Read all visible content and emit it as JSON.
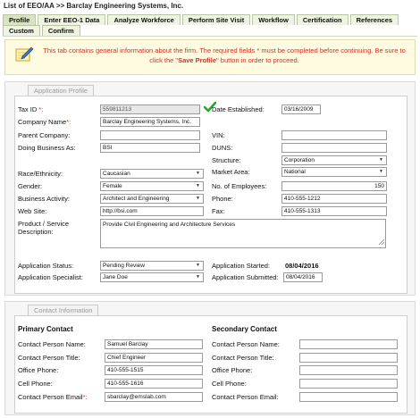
{
  "breadcrumb": "List of EEO/AA >> Barclay Engineering Systems, Inc.",
  "tabs": [
    "Profile",
    "Enter EEO-1 Data",
    "Analyze Workforce",
    "Perform Site Visit",
    "Workflow",
    "Certification",
    "References",
    "Custom",
    "Confirm"
  ],
  "notice": {
    "icon": "note-pencil-icon",
    "text_before": "This tab contains general information about the firm. The required fields * must be completed before continuing. Be sure to click the \"",
    "bold": "Save Profile",
    "text_after": "\" button in order to proceed."
  },
  "profile": {
    "legend": "Application Profile",
    "tax_id_label": "Tax ID",
    "tax_id": "559811213",
    "company_name_label": "Company Name",
    "company_name": "Barclay Engineering Systems, Inc.",
    "parent_company_label": "Parent Company:",
    "parent_company": "",
    "dba_label": "Doing Business As:",
    "dba": "BSI",
    "date_established_label": "Date Established:",
    "date_established": "03/16/2009",
    "vin_label": "VIN:",
    "vin": "",
    "duns_label": "DUNS:",
    "duns": "",
    "structure_label": "Structure:",
    "structure": "Corporation",
    "race_label": "Race/Ethnicity:",
    "race": "Caucasian",
    "market_label": "Market Area:",
    "market": "National",
    "gender_label": "Gender:",
    "gender": "Female",
    "employees_label": "No. of Employees:",
    "employees": "150",
    "activity_label": "Business Activity:",
    "activity": "Architect and Engineering",
    "phone_label": "Phone:",
    "phone": "410-555-1212",
    "website_label": "Web Site:",
    "website": "http://bsi.com",
    "fax_label": "Fax:",
    "fax": "410-555-1313",
    "product_label_1": "Product / Service",
    "product_label_2": "Description:",
    "product": "Provide Civil Engineering and Architecture Services",
    "status_label": "Application Status:",
    "status": "Pending Review",
    "specialist_label": "Application Specialist:",
    "specialist": "Jane Doe",
    "started_label": "Application Started:",
    "started": "08/04/2016",
    "submitted_label": "Application Submitted:",
    "submitted": "08/04/2016"
  },
  "contact": {
    "legend": "Contact Information",
    "primary_title": "Primary Contact",
    "secondary_title": "Secondary Contact",
    "name_label": "Contact Person Name:",
    "title_label": "Contact Person Title:",
    "office_label": "Office Phone:",
    "cell_label": "Cell Phone:",
    "email_label": "Contact Person Email",
    "email2_label": "Contact Person Email:",
    "primary": {
      "name": "Samuel Barclay",
      "title": "Chief Engineer",
      "office": "410-555-1515",
      "cell": "410-555-1616",
      "email": "sbarclay@emslab.com"
    },
    "secondary": {
      "name": "",
      "title": "",
      "office": "",
      "cell": "",
      "email": ""
    }
  },
  "colors": {
    "tab_bg": "#eef3e2",
    "notice_text": "#d0302a",
    "check": "#2aa52a"
  }
}
